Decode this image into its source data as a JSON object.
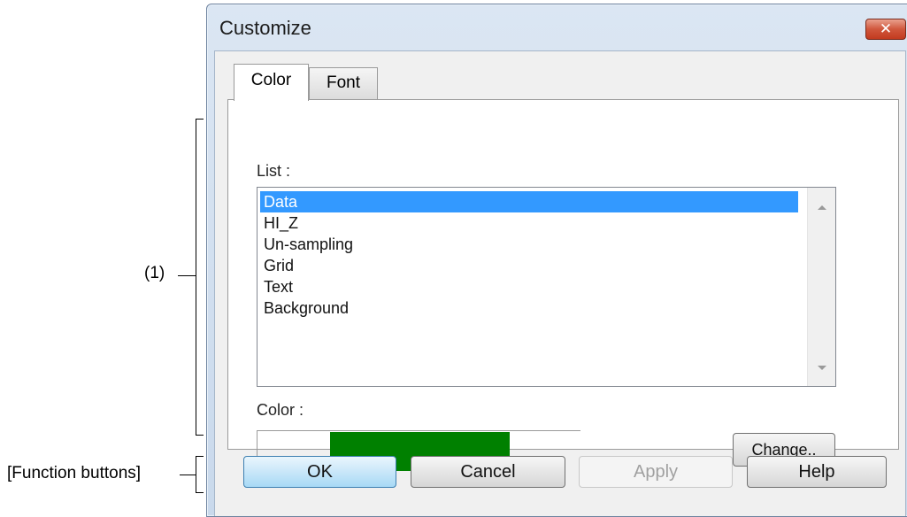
{
  "annotations": {
    "area_marker": "(1)",
    "function_buttons": "[Function buttons]"
  },
  "dialog": {
    "title": "Customize",
    "close_label": "✕",
    "tabs": [
      {
        "label": "Color",
        "selected": true
      },
      {
        "label": "Font",
        "selected": false
      }
    ],
    "list_label": "List :",
    "list_items": [
      {
        "label": "Data",
        "selected": true
      },
      {
        "label": "HI_Z",
        "selected": false
      },
      {
        "label": "Un-sampling",
        "selected": false
      },
      {
        "label": "Grid",
        "selected": false
      },
      {
        "label": "Text",
        "selected": false
      },
      {
        "label": "Background",
        "selected": false
      }
    ],
    "color_label": "Color :",
    "color_swatch": "#008000",
    "change_button": "Change..",
    "buttons": {
      "ok": "OK",
      "cancel": "Cancel",
      "apply": "Apply",
      "help": "Help"
    }
  },
  "colors": {
    "selection": "#3399ff",
    "swatch": "#008000",
    "close_button": "#c23a1f"
  }
}
